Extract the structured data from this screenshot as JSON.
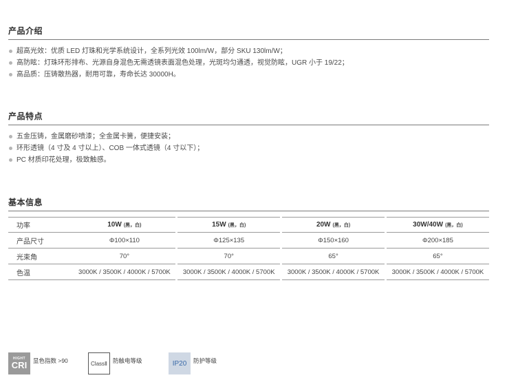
{
  "intro": {
    "title": "产品介绍",
    "items": [
      "超高光效：优质 LED 灯珠和光学系统设计，全系列光效 100lm/W，部分 SKU 130lm/W；",
      "高防眩：灯珠环形排布、光源自身混色无需透镜表面混色处理，光斑均匀通透，视觉防眩，UGR 小于 19/22；",
      "高品质：压铸散热器，耐用可靠，寿命长达 30000H。"
    ]
  },
  "features": {
    "title": "产品特点",
    "items": [
      "五金压铸，金属磨砂喷漆；全金属卡簧，便捷安装；",
      "环形透镜（4 寸及 4 寸以上）、COB 一体式透镜（4 寸以下）；",
      "PC 材质印花处理，极致触感。"
    ]
  },
  "basic": {
    "title": "基本信息",
    "table": {
      "header_label": "功率",
      "columns": [
        {
          "power": "10W",
          "colors": "(黑，白)"
        },
        {
          "power": "15W",
          "colors": "(黑，白)"
        },
        {
          "power": "20W",
          "colors": "(黑，白)"
        },
        {
          "power": "30W/40W",
          "colors": "(黑，白)"
        }
      ],
      "rows": [
        {
          "label": "产品尺寸",
          "values": [
            "Φ100×110",
            "Φ125×135",
            "Φ150×160",
            "Φ200×185"
          ]
        },
        {
          "label": "光束角",
          "values": [
            "70°",
            "70°",
            "65°",
            "65°"
          ]
        },
        {
          "label": "色温",
          "values": [
            "3000K / 3500K / 4000K / 5700K",
            "3000K / 3500K / 4000K / 5700K",
            "3000K / 3500K / 4000K / 5700K",
            "3000K / 3500K / 4000K / 5700K"
          ]
        }
      ]
    }
  },
  "badges": {
    "cri": {
      "small": "HIGHT",
      "big": "CRI",
      "label": "显色指数 >90"
    },
    "class": {
      "text": "ClassⅡ",
      "label": "防触电等级"
    },
    "ip": {
      "text": "IP20",
      "label": "防护等级"
    }
  }
}
